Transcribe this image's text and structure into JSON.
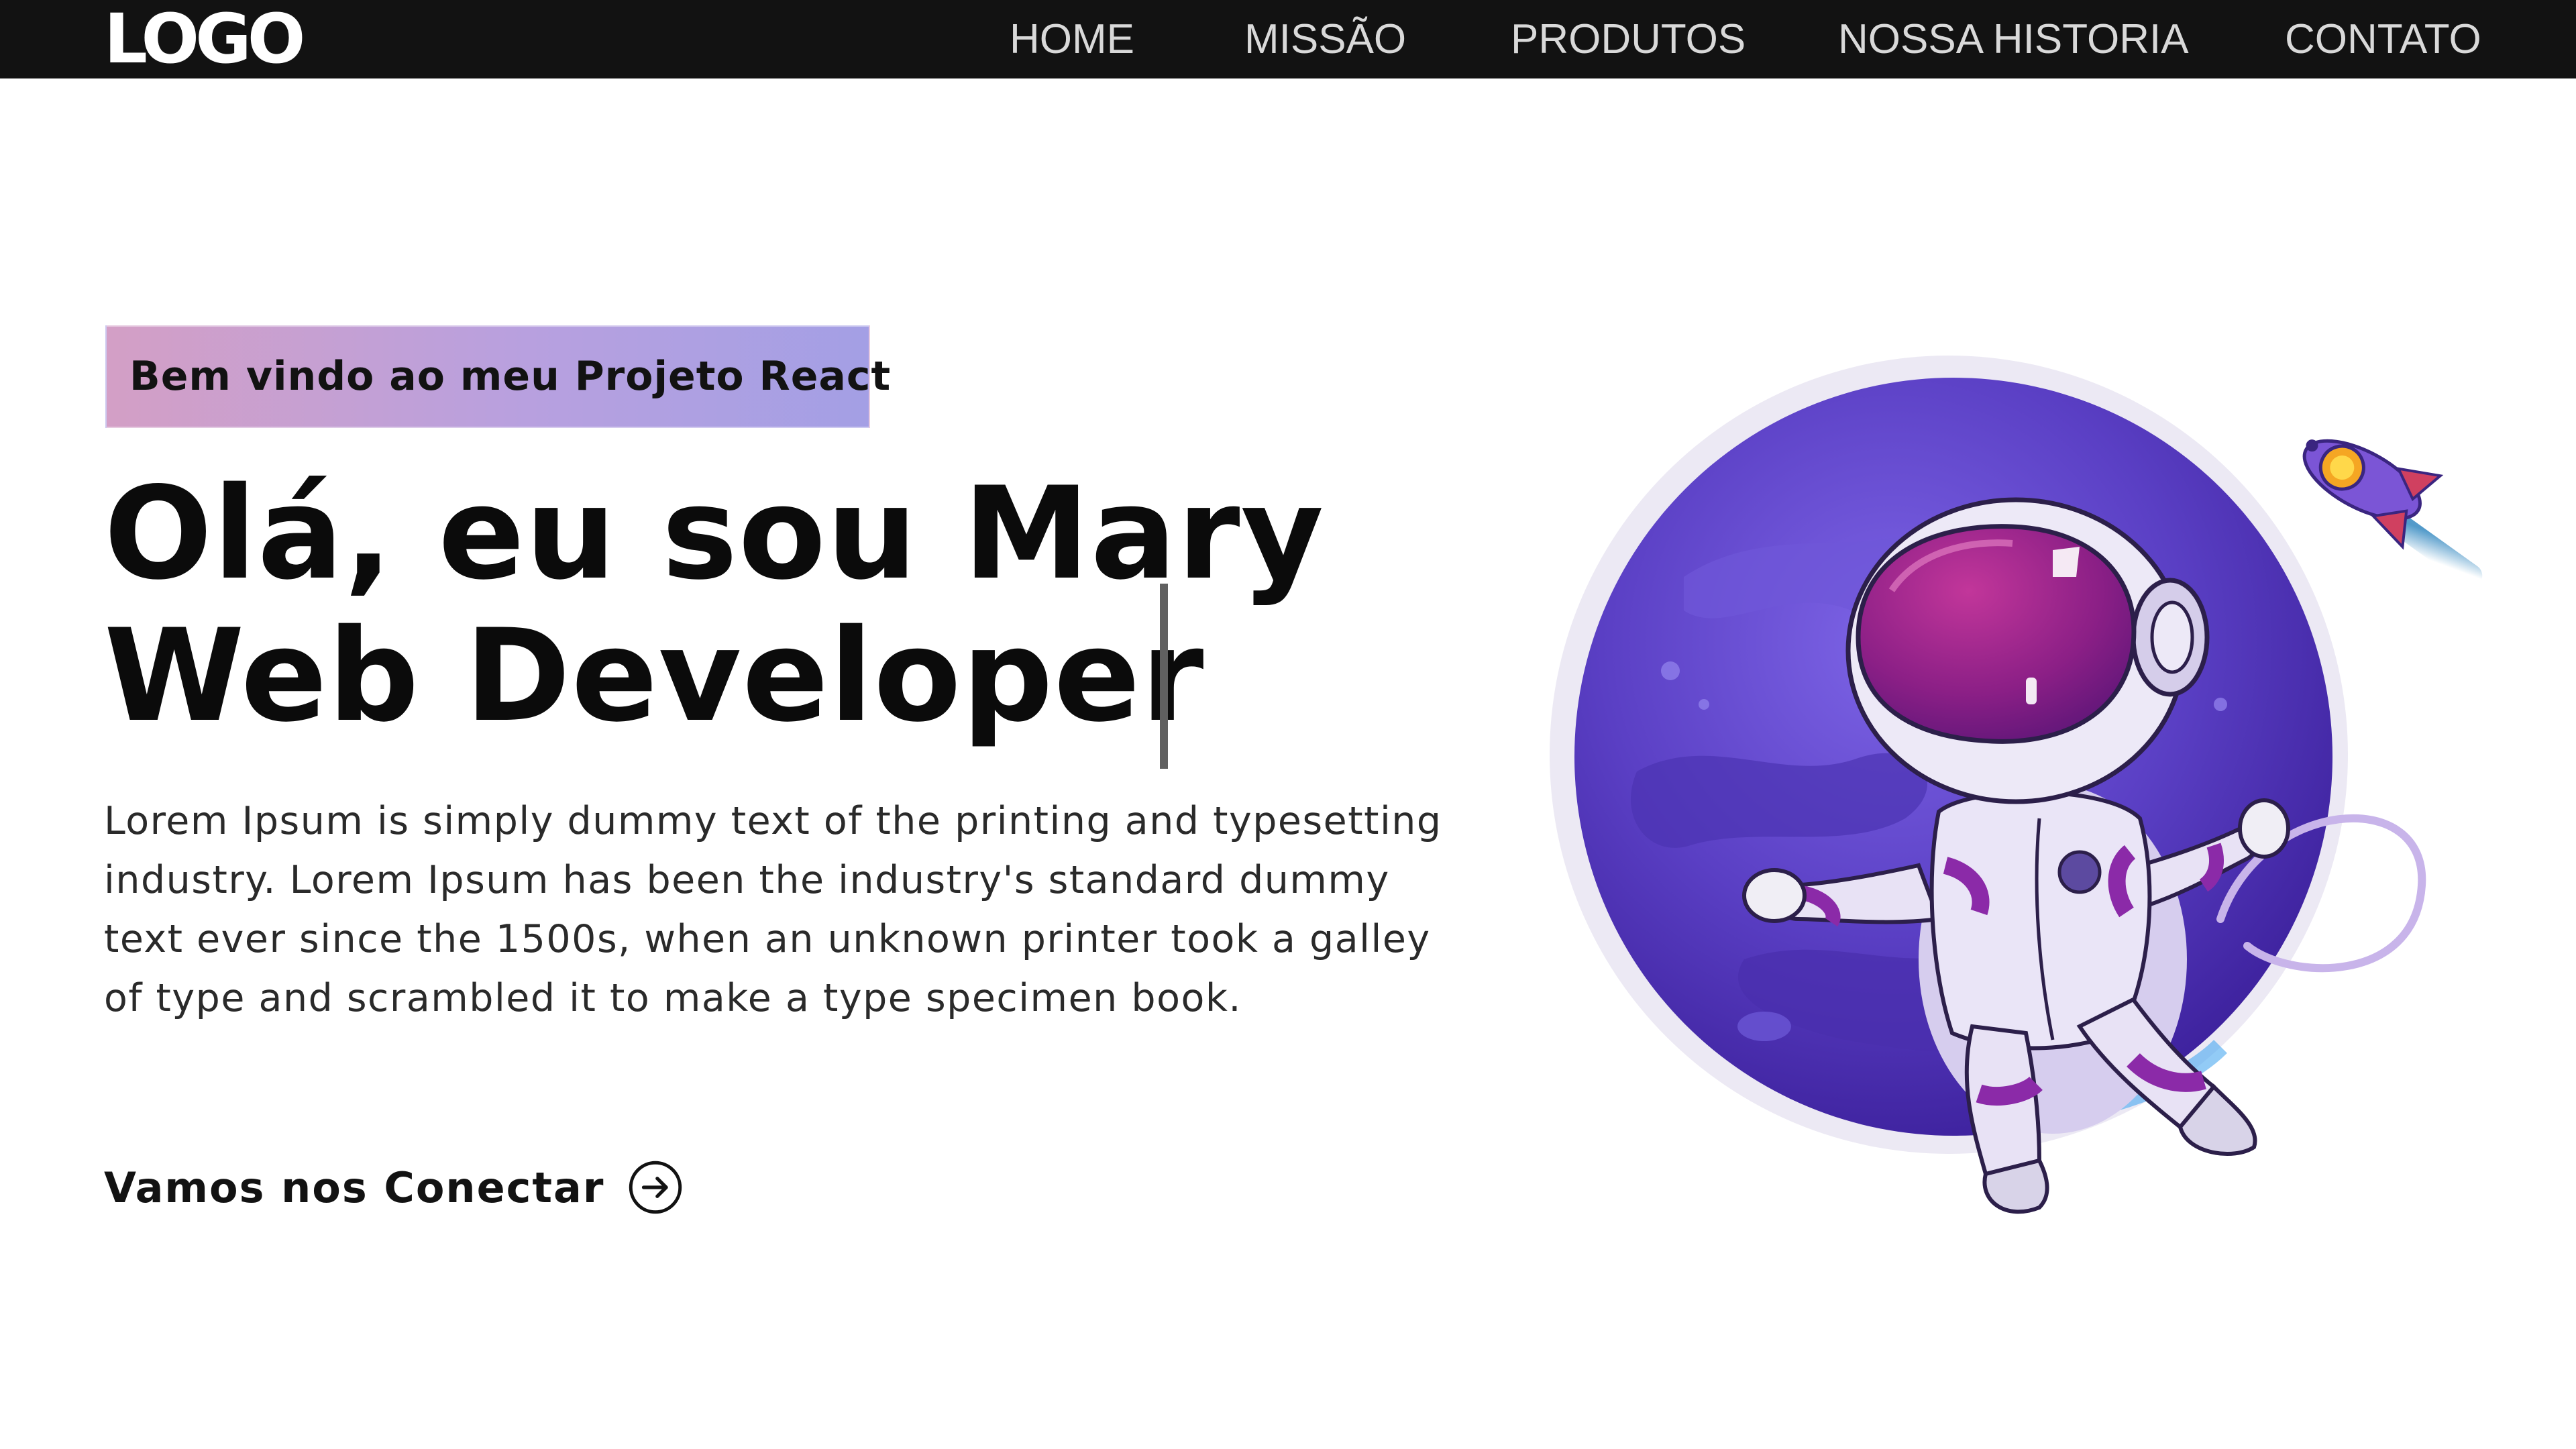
{
  "navbar": {
    "logo": "LOGO",
    "links": [
      {
        "label": "HOME"
      },
      {
        "label": "MISSÃO"
      },
      {
        "label": "PRODUTOS"
      },
      {
        "label": "NOSSA HISTORIA"
      },
      {
        "label": "CONTATO"
      }
    ]
  },
  "hero": {
    "tagline": "Bem vindo ao meu Projeto React",
    "headline_line1": "Olá, eu sou Mary",
    "headline_line2": "Web Developer",
    "description": "Lorem Ipsum is simply dummy text of the printing and typesetting industry. Lorem Ipsum has been the industry's standard dummy text ever since the 1500s, when an unknown printer took a galley of type and scrambled it to make a type specimen book.",
    "cta_label": "Vamos nos Conectar"
  },
  "illustration": {
    "subject": "astronaut-with-planet-and-rocket",
    "colors": {
      "planet": "#5a3fc4",
      "planet_light": "#7a5fe0",
      "suit": "#e8e2f5",
      "suit_accent": "#8b2aa8",
      "visor": "#a3288f",
      "rocket": "#7b55d6"
    }
  },
  "colors": {
    "navbar_bg": "#121212",
    "nav_text": "#d9d9d9",
    "tagline_gradient_start": "#d69fc3",
    "tagline_gradient_end": "#9f9fe6",
    "text": "#0b0b0b",
    "background": "#ffffff"
  }
}
